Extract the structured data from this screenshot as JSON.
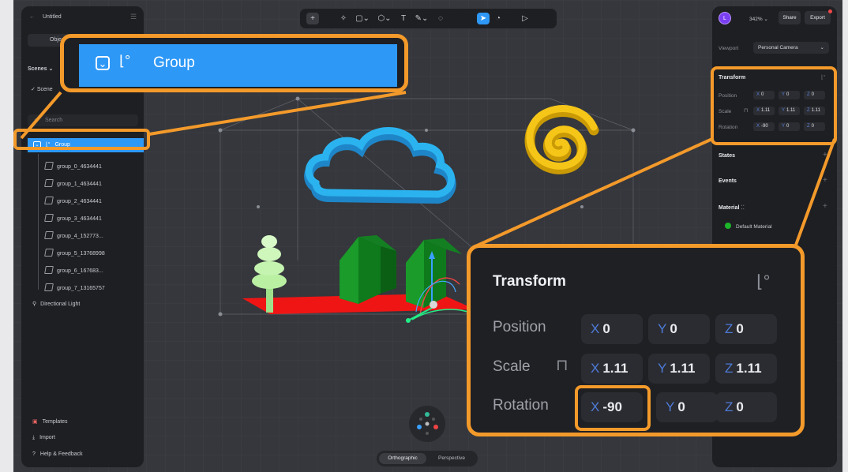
{
  "app": {
    "title": "Untitled",
    "zoom": "342%",
    "share_label": "Share",
    "export_label": "Export",
    "avatar_letter": "L"
  },
  "left_panel": {
    "tab_objects": "Objects",
    "scenes_label": "Scenes",
    "scene_item": "Scene",
    "search_placeholder": "Search",
    "tree": [
      {
        "label": "Group",
        "selected": true
      },
      {
        "label": "group_0_4634441"
      },
      {
        "label": "group_1_4634441"
      },
      {
        "label": "group_2_4634441"
      },
      {
        "label": "group_3_4634441"
      },
      {
        "label": "group_4_152773..."
      },
      {
        "label": "group_5_13768998"
      },
      {
        "label": "group_6_167683..."
      },
      {
        "label": "group_7_13165757"
      },
      {
        "label": "Directional Light"
      }
    ],
    "footer": {
      "templates": "Templates",
      "import": "Import",
      "help": "Help & Feedback"
    }
  },
  "right_panel": {
    "viewport_label": "Viewport",
    "viewport_value": "Personal Camera",
    "transform_title": "Transform",
    "position_label": "Position",
    "scale_label": "Scale",
    "rotation_label": "Rotation",
    "position": {
      "x": "0",
      "y": "0",
      "z": "0"
    },
    "scale": {
      "x": "1.11",
      "y": "1.11",
      "z": "1.11"
    },
    "rotation": {
      "x": "-90",
      "y": "0",
      "z": "0"
    },
    "states_label": "States",
    "events_label": "Events",
    "material_label": "Material",
    "material_value": "Default Material"
  },
  "axis_letters": {
    "x": "X",
    "y": "Y",
    "z": "Z"
  },
  "view_modes": {
    "orthographic": "Orthographic",
    "perspective": "Perspective",
    "active": "orthographic"
  },
  "zoom_callouts": {
    "group_label": "Group",
    "transform_title": "Transform",
    "position_label": "Position",
    "scale_label": "Scale",
    "rotation_label": "Rotation"
  },
  "colors": {
    "highlight": "#f39a2b",
    "selection": "#2e98f6",
    "panel": "#1e1f23",
    "canvas": "#35373c",
    "cloud": "#2bb3f0",
    "spiral": "#f5c518",
    "house": "#1a9b2a",
    "tree": "#b9f0a2",
    "ground": "#f01515"
  }
}
